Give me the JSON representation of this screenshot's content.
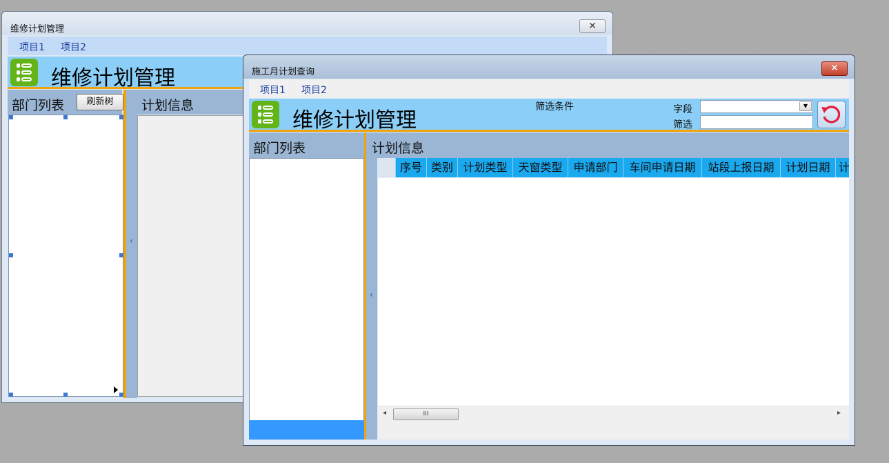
{
  "back_window": {
    "title": "维修计划管理",
    "close_glyph": "✕",
    "menu": [
      "项目1",
      "项目2"
    ],
    "banner_title": "维修计划管理",
    "dept_header": "部门列表",
    "refresh_button": "刷新树",
    "plan_header": "计划信息",
    "splitter_glyph": "‹"
  },
  "front_window": {
    "title": "施工月计划查询",
    "close_glyph": "✕",
    "menu": [
      "项目1",
      "项目2"
    ],
    "banner_title": "维修计划管理",
    "filter_title": "筛选条件",
    "field_label": "字段",
    "filter_label": "筛选",
    "field_value": "",
    "filter_value": "",
    "dept_header": "部门列表",
    "plan_header": "计划信息",
    "splitter_glyph": "‹",
    "grid_columns": [
      "序号",
      "类别",
      "计划类型",
      "天窗类型",
      "申请部门",
      "车间申请日期",
      "站段上报日期",
      "计划日期",
      "计"
    ],
    "scroll_left": "◂",
    "scroll_right": "▸",
    "scroll_thumb": "III"
  },
  "icons": {
    "logo": "list-logo-icon",
    "reset": "refresh-reset-icon"
  },
  "colors": {
    "banner": "#8bcff8",
    "accent_orange": "#f0a30a",
    "grid_header": "#1aa8ef",
    "logo_green": "#62b418",
    "dept_footer": "#3399ff"
  }
}
